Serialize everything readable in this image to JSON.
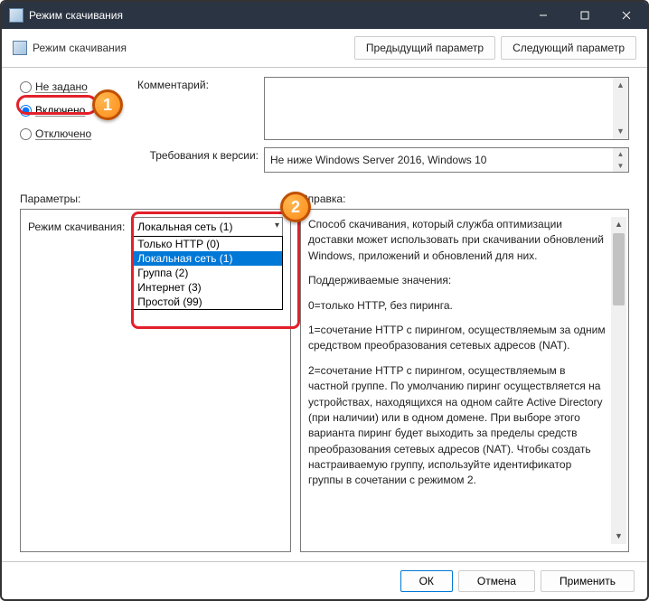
{
  "window": {
    "title": "Режим скачивания"
  },
  "header": {
    "title": "Режим скачивания",
    "prev": "Предыдущий параметр",
    "next": "Следующий параметр"
  },
  "radios": {
    "not_set": "Не задано",
    "enabled": "Включено",
    "disabled": "Отключено"
  },
  "labels": {
    "comment": "Комментарий:",
    "version_req": "Требования к версии:",
    "params": "Параметры:",
    "help": "Справка:",
    "mode": "Режим скачивания:"
  },
  "version": "Не ниже Windows Server 2016, Windows 10",
  "combo": {
    "selected": "Локальная сеть (1)",
    "options": [
      "Только HTTP (0)",
      "Локальная сеть (1)",
      "Группа (2)",
      "Интернет (3)",
      "Простой (99)"
    ],
    "selected_index": 1
  },
  "help": {
    "p1": "Способ скачивания, который служба оптимизации доставки может использовать при скачивании обновлений Windows, приложений и обновлений для них.",
    "p2": "Поддерживаемые значения:",
    "p3": "0=только HTTP, без пиринга.",
    "p4": "1=сочетание HTTP с пирингом, осуществляемым за одним средством преобразования сетевых адресов (NAT).",
    "p5": "2=сочетание HTTP с пирингом, осуществляемым в частной группе. По умолчанию пиринг осуществляется на устройствах, находящихся на одном сайте Active Directory (при наличии) или в одном домене. При выборе этого варианта пиринг будет выходить за пределы средств преобразования сетевых адресов (NAT). Чтобы создать настраиваемую группу, используйте идентификатор группы в сочетании с режимом 2."
  },
  "buttons": {
    "ok": "ОК",
    "cancel": "Отмена",
    "apply": "Применить"
  },
  "badges": {
    "one": "1",
    "two": "2"
  }
}
